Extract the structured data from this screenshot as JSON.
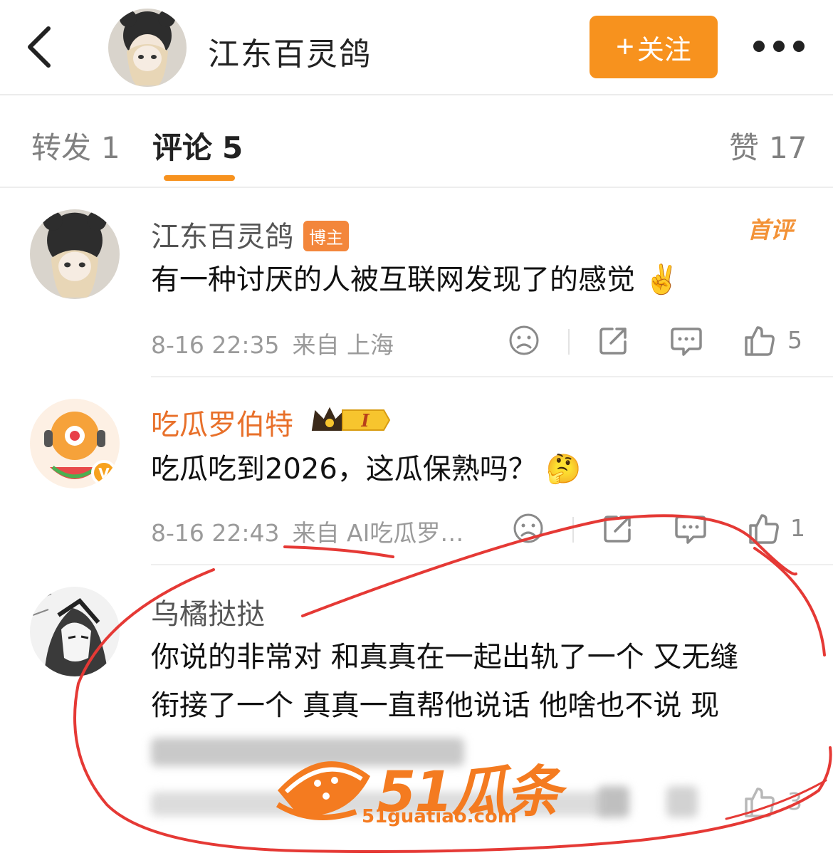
{
  "header": {
    "title": "江东百灵鸽",
    "follow_plus": "+",
    "follow_label": "关注",
    "back_icon": "chevron-left-icon",
    "more_icon": "more-dots-icon"
  },
  "tabs": [
    {
      "label": "转发",
      "count": "1",
      "active": false
    },
    {
      "label": "评论",
      "count": "5",
      "active": true
    },
    {
      "label": "赞",
      "count": "17",
      "active": false
    }
  ],
  "hot_badge": "首评",
  "comments": [
    {
      "name": "江东百灵鸽",
      "badge": "博主",
      "text": "有一种讨厌的人被互联网发现了的感觉 ✌️",
      "time": "8-16 22:35",
      "source": "来自 上海",
      "likes": "5"
    },
    {
      "name": "吃瓜罗伯特",
      "badge_level": "I",
      "text": "吃瓜吃到2026，这瓜保熟吗？ 🤔",
      "time": "8-16 22:43",
      "source": "来自 AI吃瓜罗…",
      "likes": "1"
    },
    {
      "name": "乌橘挞挞",
      "text_line1": "你说的非常对 和真真在一起出轨了一个 又无缝",
      "text_line2": "衔接了一个 真真一直帮他说话 他啥也不说 现",
      "likes": "3"
    }
  ],
  "watermark": {
    "brand": "51瓜条",
    "url": "51guatiao.com"
  },
  "colors": {
    "accent": "#f7921e",
    "name_orange": "#e8702a",
    "annotation_red": "#e53935"
  }
}
